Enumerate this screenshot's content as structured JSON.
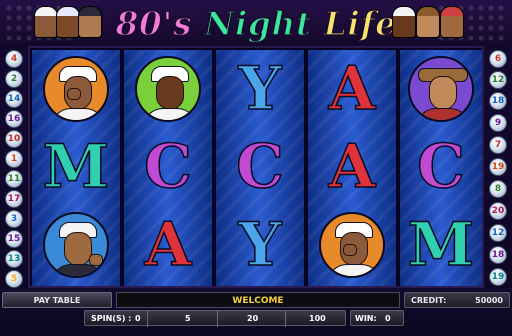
{
  "game": {
    "title_part1": "80's",
    "title_part2": "Night",
    "title_part3": "Life"
  },
  "paylines": {
    "left": [
      "4",
      "2",
      "14",
      "16",
      "10",
      "1",
      "11",
      "17",
      "3",
      "15",
      "13",
      "5"
    ],
    "right": [
      "6",
      "12",
      "18",
      "9",
      "7",
      "19",
      "8",
      "20",
      "12",
      "18",
      "19"
    ]
  },
  "reels": [
    [
      "character-breakdancer",
      "M",
      "character-sunglasses"
    ],
    [
      "character-sailor",
      "C",
      "A"
    ],
    [
      "Y",
      "C",
      "Y"
    ],
    [
      "A",
      "A",
      "character-breakdancer"
    ],
    [
      "character-cowboy",
      "C",
      "M"
    ]
  ],
  "controls": {
    "pay_table_label": "PAY TABLE",
    "spins_label": "SPIN(S) :",
    "spins_value": "0",
    "bet_value": "5",
    "lines_value": "20",
    "total_bet_value": "100",
    "win_label": "WIN:",
    "win_value": "0",
    "credit_label": "CREDIT:",
    "credit_value": "50000",
    "message": "WELCOME"
  },
  "colors": {
    "title_pink": "#f37cd8",
    "title_green": "#39e89a",
    "title_yellow": "#f6e36a",
    "reel_blue": "#2a5bd0",
    "message_yellow": "#f4d23c"
  }
}
